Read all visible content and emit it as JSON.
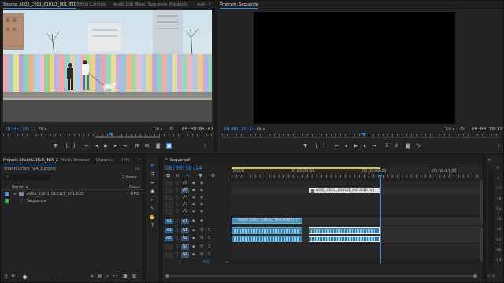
{
  "source": {
    "tabs": [
      {
        "label": "Source: A002_C001_0101LT_001.R3D",
        "active": true
      },
      {
        "label": "Effect Controls"
      },
      {
        "label": "Audio Clip Mixer: Sequence"
      },
      {
        "label": "Metadata"
      },
      {
        "label": "Aud"
      }
    ],
    "timecode_current": "20:35:30:13",
    "fit": "Fit",
    "quality": "1/4",
    "timecode_duration": "00:00:05:02"
  },
  "program": {
    "tab": "Program: Sequence",
    "timecode_current": "00:00:10:14",
    "fit": "Fit",
    "quality": "1/4",
    "timecode_duration": "00:00:19:19"
  },
  "project": {
    "tabs": [
      {
        "label": "Project: ShootCutTalk_NIA_2",
        "active": true
      },
      {
        "label": "Media Browser"
      },
      {
        "label": "Libraries"
      },
      {
        "label": "Info"
      }
    ],
    "file_name": "ShootCutTalk_NIA_2.prproj",
    "item_count": "2 Items",
    "col_name": "Name",
    "col_desc": "Descr",
    "items": [
      {
        "name": "A002_C001_0101LT_001.R3D",
        "desc": "RMS",
        "color": "#6e8fd8"
      },
      {
        "name": "Sequence",
        "desc": "",
        "color": "#3bb54a"
      }
    ]
  },
  "timeline": {
    "tab": "Sequence",
    "timecode": "00:00:10:14",
    "ruler_labels": [
      ":00:00",
      "00:00:04:23",
      "00:00:09:23",
      "00:00:14:23"
    ],
    "video_tracks": [
      "V6",
      "V5",
      "V4",
      "V3",
      "V2",
      "V1"
    ],
    "audio_tracks": [
      "A1",
      "A2",
      "A3",
      "A4"
    ],
    "master_value": "0.0",
    "clip_v6_label": "A002_C001_0101LT_001.R3D [V]",
    "clip_v1_label": "A002_C001_0101LT_001.R3D [V]",
    "meter_labels": [
      "0",
      "-6",
      "-12",
      "-18",
      "-24",
      "-30",
      "-36",
      "-42",
      "-48",
      "-54"
    ]
  },
  "colors": {
    "accent": "#2d8ceb",
    "clip_video": "#4c8fb4",
    "clip_audio": "#3b7fa6"
  }
}
